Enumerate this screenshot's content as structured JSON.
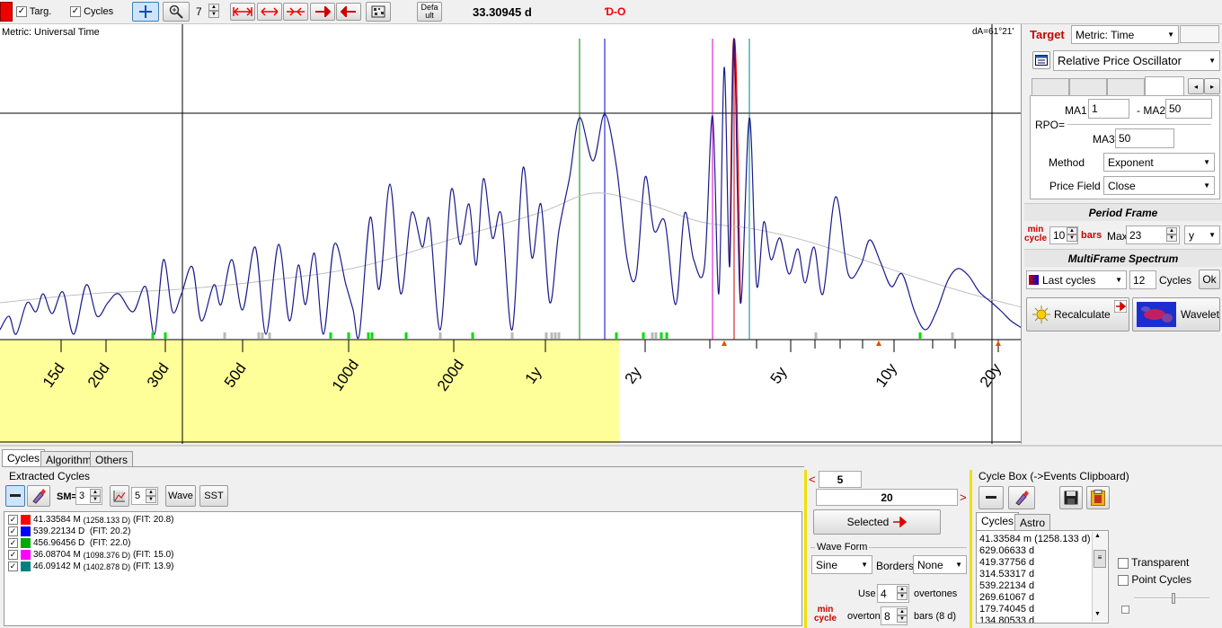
{
  "toolbar": {
    "targ_label": "Targ.",
    "cycles_label": "Cycles",
    "zoom_value": "7",
    "default_label_1": "Defa",
    "default_label_2": "ult",
    "period_readout": "33.30945 d",
    "phase_symbol": "Ɗ-O"
  },
  "chart": {
    "metric_label": "Metric: Universal Time",
    "da_label": "dA=61°21'",
    "axis_labels": [
      "15d",
      "20d",
      "30d",
      "50d",
      "100d",
      "200d",
      "1y",
      "2y",
      "5y",
      "10y",
      "20y"
    ],
    "colors": {
      "highlight": "#ffff99",
      "curve": "#1a1a8c"
    },
    "chart_data": {
      "type": "line",
      "title": "",
      "xlabel": "",
      "ylabel": "",
      "log_x": true,
      "x_ticks": [
        "15d",
        "20d",
        "30d",
        "50d",
        "100d",
        "200d",
        "1y",
        "2y",
        "5y",
        "10y",
        "20y"
      ],
      "cycle_markers": [
        {
          "color": "#008000",
          "period": "456.96456 D"
        },
        {
          "color": "#0000cc",
          "period": "539.22134 D"
        },
        {
          "color": "#cc00cc",
          "period": "1098.376 D"
        },
        {
          "color": "#cc0000",
          "period": "1258.133 D"
        },
        {
          "color": "#008080",
          "period": "1402.878 D"
        }
      ]
    }
  },
  "right_panel": {
    "target_label": "Target",
    "metric_select": "Metric: Time",
    "indicator_select": "Relative Price Oscillator",
    "ma1_label": "MA1",
    "ma1_value": "1",
    "ma2_label": "- MA2",
    "ma2_value": "50",
    "rpo_label": "RPO=",
    "ma3_label": "MA3",
    "ma3_value": "50",
    "method_label": "Method",
    "method_value": "Exponent",
    "price_field_label": "Price Field",
    "price_field_value": "Close",
    "period_frame_title": "Period Frame",
    "min_label": "min",
    "cycle_label": "cycle",
    "min_value": "10",
    "bars_label": "bars",
    "max_label": "Max",
    "max_value": "23",
    "unit_value": "y",
    "mfs_title": "MultiFrame Spectrum",
    "last_cycles": "Last cycles",
    "cycles_count": "12",
    "cycles_label": "Cycles",
    "ok_label": "Ok",
    "recalculate_label": "Recalculate",
    "wavelet_label": "Wavelet"
  },
  "bottom": {
    "tabs": [
      "Cycles",
      "Algorithm",
      "Others"
    ],
    "extracted_title": "Extracted Cycles",
    "sm_label": "SM=",
    "sm_value": "3",
    "num_value": "5",
    "wave_label": "Wave",
    "sst_label": "SST",
    "cycles": [
      {
        "color": "#ff0000",
        "text_main": "41.33584 M",
        "text_sub": "(1258.133 D)",
        "fit": "(FIT: 20.8)"
      },
      {
        "color": "#0000ff",
        "text_main": "539.22134 D",
        "text_sub": "",
        "fit": "(FIT: 20.2)"
      },
      {
        "color": "#00aa00",
        "text_main": "456.96456 D",
        "text_sub": "",
        "fit": "(FIT: 22.0)"
      },
      {
        "color": "#ff00ff",
        "text_main": "36.08704 M",
        "text_sub": "(1098.376 D)",
        "fit": "(FIT: 15.0)"
      },
      {
        "color": "#008080",
        "text_main": "46.09142 M",
        "text_sub": "(1402.878 D)",
        "fit": "(FIT: 13.9)"
      }
    ],
    "range_low": "5",
    "range_high": "20",
    "selected_label": "Selected",
    "wave_form_title": "Wave Form",
    "wave_type": "Sine",
    "borders_label": "Borders",
    "borders_value": "None",
    "use_label": "Use",
    "use_value": "4",
    "overtones_label": "overtones",
    "min_label": "min",
    "cycle_label": "cycle",
    "overtone_label": "overtone",
    "overtone_value": "8",
    "bars_label": "bars (8 d)"
  },
  "cycle_box": {
    "title": "Cycle Box (->Events Clipboard)",
    "tabs": [
      "Cycles",
      "Astro"
    ],
    "items": [
      "41.33584 m (1258.133 d)",
      "629.06633 d",
      "419.37756 d",
      "314.53317 d",
      "539.22134 d",
      "269.61067 d",
      "179.74045 d",
      "134.80533 d"
    ]
  },
  "options": {
    "transparent_label": "Transparent",
    "point_cycles_label": "Point Cycles"
  }
}
